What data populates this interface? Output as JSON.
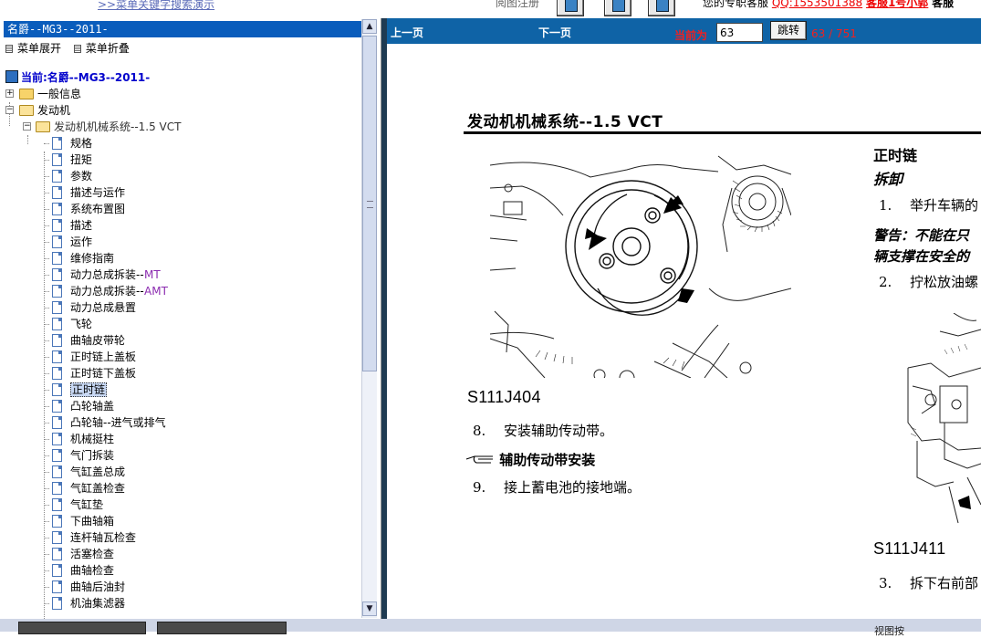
{
  "topbar": {
    "search_demo_link": ">>菜单关键字搜索演示",
    "faded_label": "阅图注册",
    "service_label": "您的专职客服",
    "service_qq": "QQ:1553501388",
    "service_red": "客服1号小郭",
    "service_tail": "客服"
  },
  "left": {
    "header": "名爵--MG3--2011-",
    "expand_all": "菜单展开",
    "collapse_all": "菜单折叠",
    "current_label": "当前:名爵--MG3--2011-",
    "general_info": "一般信息",
    "engine": "发动机",
    "engine_mech": "发动机机械系统--1.5 VCT",
    "items": [
      {
        "label": "规格"
      },
      {
        "label": "扭矩"
      },
      {
        "label": "参数"
      },
      {
        "label": "描述与运作"
      },
      {
        "label": "系统布置图"
      },
      {
        "label": "描述"
      },
      {
        "label": "运作"
      },
      {
        "label": "维修指南"
      },
      {
        "label": "动力总成拆装--",
        "suffix": "MT"
      },
      {
        "label": "动力总成拆装-- ",
        "suffix": "AMT"
      },
      {
        "label": "动力总成悬置"
      },
      {
        "label": "飞轮"
      },
      {
        "label": "曲轴皮带轮"
      },
      {
        "label": "正时链上盖板"
      },
      {
        "label": "正时链下盖板"
      },
      {
        "label": "正时链",
        "selected": true
      },
      {
        "label": "凸轮轴盖"
      },
      {
        "label": "凸轮轴--进气或排气"
      },
      {
        "label": "机械挺柱"
      },
      {
        "label": "气门拆装"
      },
      {
        "label": "气缸盖总成"
      },
      {
        "label": "气缸盖检查"
      },
      {
        "label": "气缸垫"
      },
      {
        "label": "下曲轴箱"
      },
      {
        "label": "连杆轴瓦检查"
      },
      {
        "label": "活塞检查"
      },
      {
        "label": "曲轴检查"
      },
      {
        "label": "曲轴后油封"
      },
      {
        "label": "机油集滤器"
      }
    ]
  },
  "nav": {
    "prev": "上一页",
    "next": "下一页",
    "current_label": "当前为",
    "page_input": "63",
    "jump_button": "跳转",
    "page_count": "63 / 751"
  },
  "document": {
    "section_title": "发动机机械系统--1.5 VCT",
    "figure_code_1": "S111J404",
    "step8_num": "8.",
    "step8_text": "安装辅助传动带。",
    "subhead": "辅助传动带安装",
    "step9_num": "9.",
    "step9_text": "接上蓄电池的接地端。",
    "right_title": "正时链",
    "right_disassembly": "拆卸",
    "step1_num": "1.",
    "step1_text": "举升车辆的",
    "warning_line1": "警告：不能在只",
    "warning_line2": "辆支撑在安全的",
    "step2_num": "2.",
    "step2_text": "拧松放油螺",
    "figure_code_2": "S111J411",
    "step3_num": "3.",
    "step3_text": "拆下右前部"
  },
  "status": {
    "bottom_right": "视图按"
  }
}
